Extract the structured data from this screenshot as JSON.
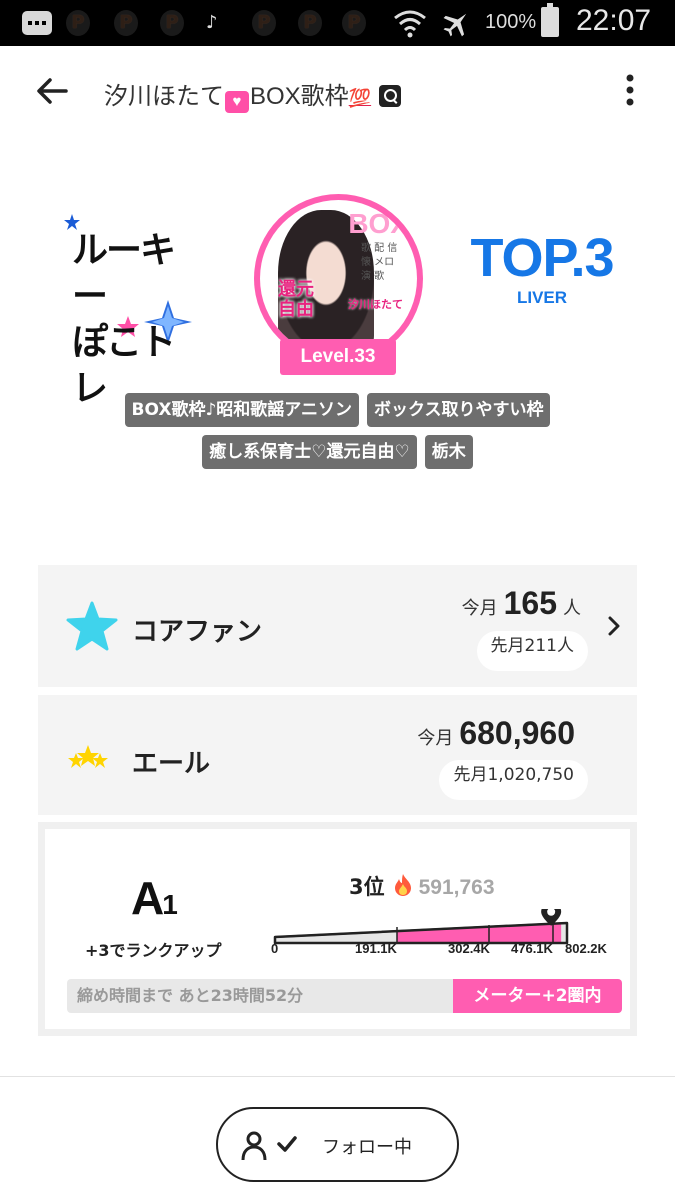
{
  "status_bar": {
    "p_icons": [
      "P",
      "P",
      "P",
      "P",
      "P",
      "P"
    ],
    "battery": "100%",
    "time": "22:07",
    "icons": [
      "message-icon",
      "tiktok-icon",
      "wifi-icon",
      "airplane-icon",
      "battery-icon"
    ]
  },
  "header": {
    "title_prefix": "汐川ほたて",
    "heart": "♥",
    "title_middle": "BOX歌枠",
    "title_suffix": "💯",
    "icons": [
      "back-arrow-icon",
      "search-box-icon",
      "more-vert-icon"
    ]
  },
  "profile": {
    "rookie_line1": "ルーキー",
    "rookie_line2": "ぽこトレ",
    "avatar_box_text": "BOX",
    "avatar_kanji_line1": "還元",
    "avatar_kanji_line2": "自由",
    "avatar_name": "汐川ほたて",
    "level": "Level.33",
    "top_main": "TOP.3",
    "top_sub": "LIVER"
  },
  "tags": [
    [
      "BOX歌枠♪昭和歌謡アニソン",
      "ボックス取りやすい枠"
    ],
    [
      "癒し系保育士♡還元自由♡",
      "栃木"
    ]
  ],
  "core_fan": {
    "label": "コアファン",
    "this_month_prefix": "今月",
    "this_month_value": "165",
    "unit": "人",
    "last_month": "先月211人"
  },
  "yell": {
    "label": "エール",
    "this_month_prefix": "今月",
    "this_month_value": "680,960",
    "last_month": "先月1,020,750"
  },
  "rank": {
    "letter": "A",
    "sub": "1",
    "rank_up": "+3でランクアップ",
    "position": "3位",
    "score": "591,763",
    "meter_fill_fraction": 0.98,
    "meter_labels": [
      "0",
      "191.1K",
      "302.4K",
      "476.1K",
      "802.2K"
    ],
    "deadline": "締め時間まで あと23時間52分",
    "meter_badge": "メーター+2圏内"
  },
  "follow": {
    "label": "フォロー中"
  },
  "colors": {
    "accent_pink": "#ff5db1",
    "top_blue": "#1677e6",
    "tag_gray": "#6e6e6e",
    "star_cyan": "#3fd3ec",
    "star_yellow": "#ffd400"
  }
}
